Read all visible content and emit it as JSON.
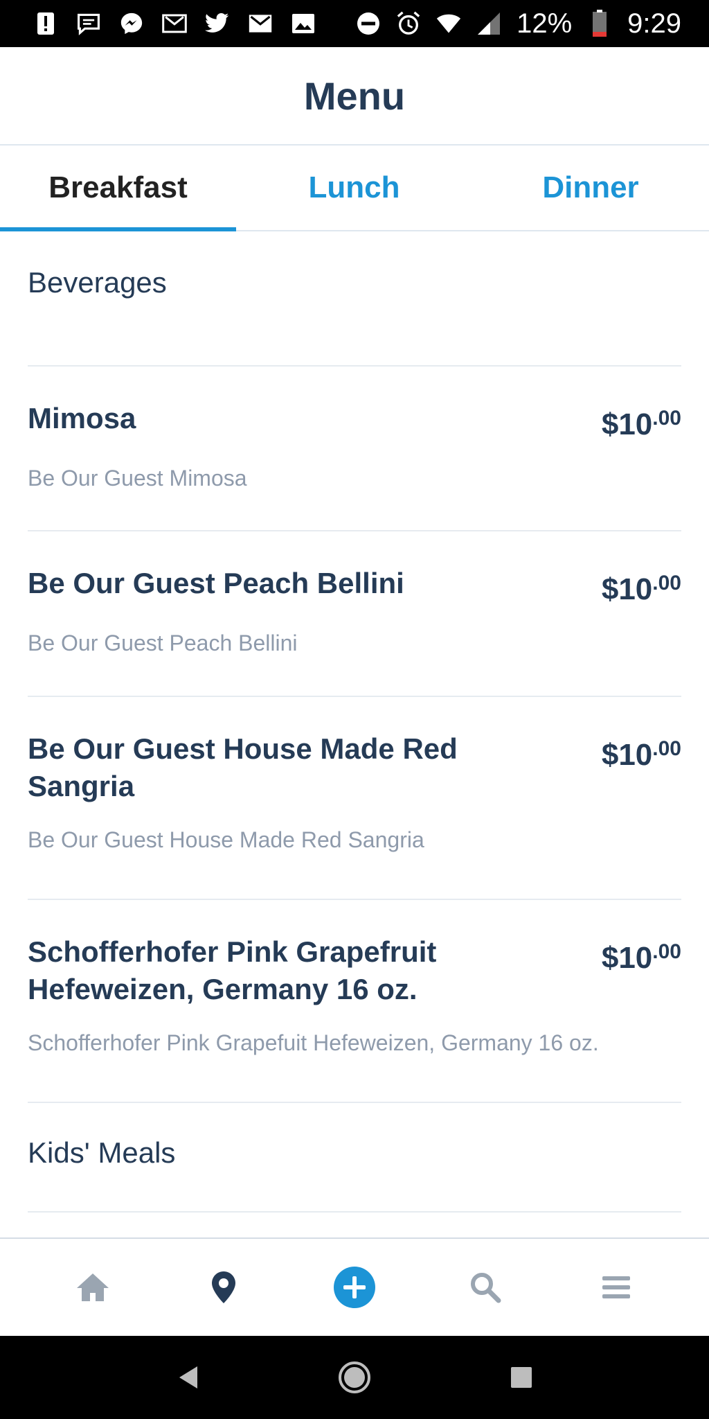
{
  "status_bar": {
    "battery": "12%",
    "time": "9:29",
    "left_icons": [
      "alert-icon",
      "chat-icon",
      "messenger-icon",
      "gmail-icon",
      "twitter-icon",
      "gmail-icon",
      "image-icon"
    ],
    "right_icons": [
      "do-not-disturb-icon",
      "alarm-icon",
      "wifi-icon",
      "signal-icon",
      "battery-icon"
    ]
  },
  "header": {
    "title": "Menu"
  },
  "tabs": [
    {
      "label": "Breakfast",
      "active": true
    },
    {
      "label": "Lunch",
      "active": false
    },
    {
      "label": "Dinner",
      "active": false
    }
  ],
  "sections": [
    {
      "heading": "Beverages",
      "items": [
        {
          "name": "Mimosa",
          "price_main": "$10",
          "price_cents": ".00",
          "description": "Be Our Guest Mimosa"
        },
        {
          "name": "Be Our Guest Peach Bellini",
          "price_main": "$10",
          "price_cents": ".00",
          "description": "Be Our Guest Peach Bellini"
        },
        {
          "name": "Be Our Guest House Made Red Sangria",
          "price_main": "$10",
          "price_cents": ".00",
          "description": "Be Our Guest House Made Red Sangria"
        },
        {
          "name": "Schofferhofer Pink Grapefruit Hefeweizen, Germany 16 oz.",
          "price_main": "$10",
          "price_cents": ".00",
          "description": "Schofferhofer Pink Grapefuit Hefeweizen, Germany 16 oz."
        }
      ]
    },
    {
      "heading": "Kids' Meals",
      "items": []
    }
  ],
  "bottom_nav": [
    "home-icon",
    "map-pin-icon",
    "plus-circle-icon",
    "search-icon",
    "hamburger-menu-icon"
  ],
  "colors": {
    "accent": "#1c94d6",
    "text_dark": "#253b56",
    "text_muted": "#8e9aab",
    "divider": "#e6ebf0"
  }
}
